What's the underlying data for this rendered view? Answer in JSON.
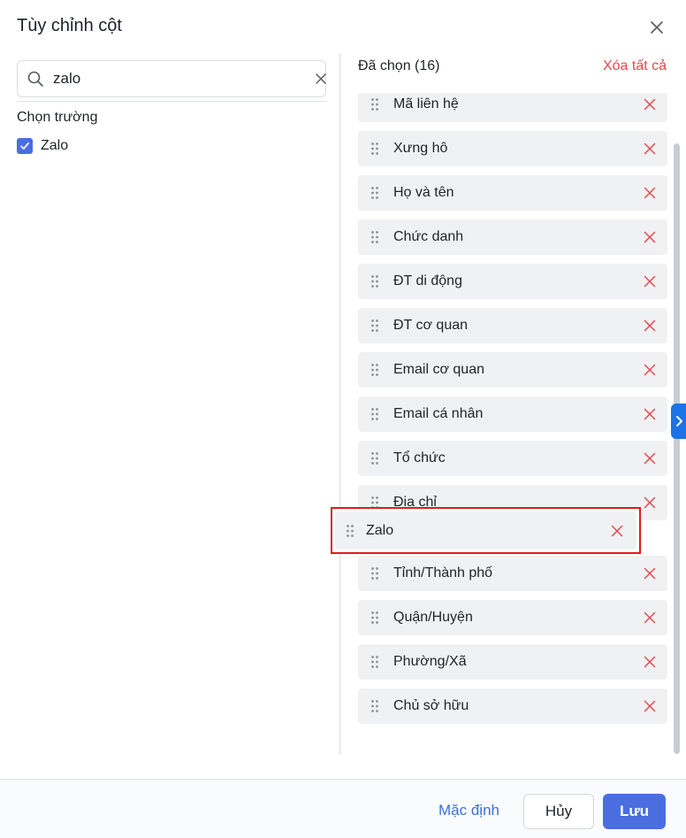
{
  "dialog": {
    "title": "Tùy chỉnh cột"
  },
  "search": {
    "value": "zalo",
    "placeholder": ""
  },
  "field_picker": {
    "section_label": "Chọn trường",
    "options": [
      {
        "label": "Zalo",
        "checked": true
      }
    ]
  },
  "selected": {
    "title": "Đã chọn (16)",
    "clear_all_label": "Xóa tất cả",
    "items": [
      {
        "label": "Mã liên hệ"
      },
      {
        "label": "Xưng hô"
      },
      {
        "label": "Họ và tên"
      },
      {
        "label": "Chức danh"
      },
      {
        "label": "ĐT di động"
      },
      {
        "label": "ĐT cơ quan"
      },
      {
        "label": "Email cơ quan"
      },
      {
        "label": "Email cá nhân"
      },
      {
        "label": "Tổ chức"
      },
      {
        "label": "Địa chỉ"
      },
      {
        "label": "Tỉnh/Thành phố"
      },
      {
        "label": "Quận/Huyện"
      },
      {
        "label": "Phường/Xã"
      },
      {
        "label": "Chủ sở hữu"
      }
    ],
    "dragging_item": {
      "label": "Zalo"
    }
  },
  "footer": {
    "default_label": "Mặc định",
    "cancel_label": "Hủy",
    "save_label": "Lưu"
  },
  "colors": {
    "accent": "#4a6ee0",
    "danger": "#e5484d",
    "highlight_border": "#e01b1b",
    "side_tab": "#1a73e8"
  },
  "icons": {
    "close": "close-icon",
    "search": "search-icon",
    "clear": "clear-icon",
    "drag": "drag-handle-icon",
    "remove": "remove-icon",
    "chevron": "chevron-right-icon",
    "check": "check-icon"
  }
}
